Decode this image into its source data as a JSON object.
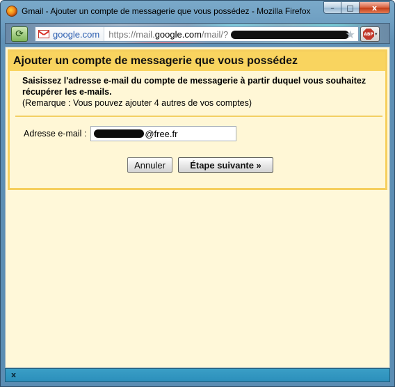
{
  "window": {
    "title": "Gmail - Ajouter un compte de messagerie que vous possédez - Mozilla Firefox",
    "controls": {
      "minimize": "–",
      "maximize": "□",
      "close": "x"
    }
  },
  "navbar": {
    "identity": "google.com",
    "url_prefix": "https://mail.",
    "url_domain": "google.com",
    "url_suffix": "/mail/?"
  },
  "dialog": {
    "title": "Ajouter un compte de messagerie que vous possédez",
    "instruction": "Saisissez l'adresse e-mail du compte de messagerie à partir duquel vous souhaitez récupérer les e-mails.",
    "note": "(Remarque : Vous pouvez ajouter 4 autres de vos comptes)",
    "email_label": "Adresse e-mail :",
    "email_value_visible": "@free.fr",
    "cancel_label": "Annuler",
    "next_label": "Étape suivante »"
  },
  "statusbar": {
    "close": "x"
  },
  "icons": {
    "app": "firefox-icon",
    "site": "site-identity-icon",
    "favicon": "gmail-icon",
    "bookmark": "star-icon",
    "addon": "adblock-plus-icon"
  },
  "colors": {
    "dialog_header": "#f9d45f",
    "dialog_background": "#fff7d6",
    "statusbar": "#2c8fbb"
  }
}
